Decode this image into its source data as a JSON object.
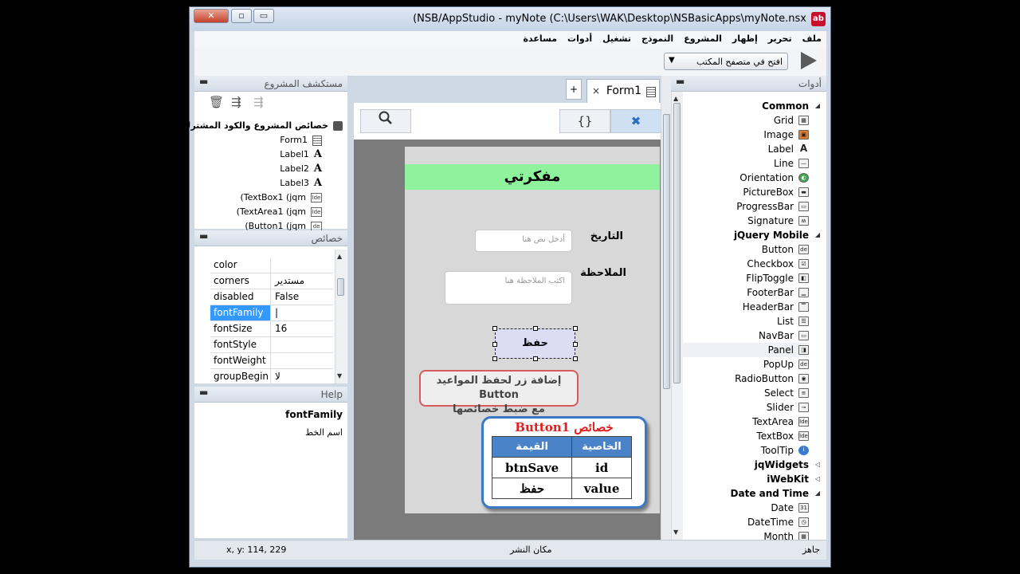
{
  "window": {
    "title": "(NSB/AppStudio - myNote (C:\\Users\\WAK\\Desktop\\NSBasicApps\\myNote.nsx",
    "icon_text": "ab"
  },
  "menu": [
    "ملف",
    "تحرير",
    "إظهار",
    "المشروع",
    "النموذج",
    "تشغيل",
    "أدوات",
    "مساعدة"
  ],
  "toolbar": {
    "browser_option": "افتح في متصفح المكتب"
  },
  "explorer": {
    "title": "مستكشف المشروع",
    "items": [
      {
        "label": "خصائص المشروع والكود المشترك",
        "icon": "gear-icon"
      },
      {
        "label": "Form1",
        "icon": "form-icon"
      },
      {
        "label": "Label1",
        "icon": "label-icon"
      },
      {
        "label": "Label2",
        "icon": "label-icon"
      },
      {
        "label": "Label3",
        "icon": "label-icon"
      },
      {
        "label": "(TextBox1 (jqm",
        "icon": "textbox-icon"
      },
      {
        "label": "(TextArea1 (jqm",
        "icon": "textarea-icon"
      },
      {
        "label": "(Button1 (jqm",
        "icon": "button-icon"
      }
    ]
  },
  "properties": {
    "title": "خصائص",
    "rows": [
      {
        "name": "color",
        "value": ""
      },
      {
        "name": "corners",
        "value": "مستدير"
      },
      {
        "name": "disabled",
        "value": "False"
      },
      {
        "name": "fontFamily",
        "value": "|"
      },
      {
        "name": "fontSize",
        "value": "16"
      },
      {
        "name": "fontStyle",
        "value": ""
      },
      {
        "name": "fontWeight",
        "value": ""
      },
      {
        "name": "groupBegin",
        "value": "لا"
      }
    ]
  },
  "help": {
    "title": "Help",
    "prop_name": "fontFamily",
    "description": "اسم الخط"
  },
  "editor": {
    "tab_label": "Form1",
    "tab_close": "×",
    "tab_add": "+",
    "code_button": "{}"
  },
  "form": {
    "header": "مفكرتي",
    "date_label": "التاريخ",
    "date_placeholder": "أدخل نص هنا",
    "note_label": "الملاحظة",
    "note_placeholder": "اكتب الملاحظة هنا",
    "save_button": "حفظ",
    "callout_line1": "إضافة زر لحفظ المواعيد Button",
    "callout_line2": "مع ضبط خصائصها",
    "card_title": "خصائص Button1",
    "card_headers": [
      "الخاصية",
      "القيمة"
    ],
    "card_rows": [
      {
        "prop": "id",
        "val": "btnSave"
      },
      {
        "prop": "value",
        "val": "حفظ"
      }
    ]
  },
  "tools": {
    "title": "أدوات",
    "items": [
      {
        "label": "Common",
        "group": true,
        "icon": "expanded"
      },
      {
        "label": "Grid",
        "icon": "grid-icon"
      },
      {
        "label": "Image",
        "icon": "image-icon"
      },
      {
        "label": "Label",
        "icon": "label-icon"
      },
      {
        "label": "Line",
        "icon": "line-icon"
      },
      {
        "label": "Orientation",
        "icon": "orientation-icon"
      },
      {
        "label": "PictureBox",
        "icon": "picturebox-icon"
      },
      {
        "label": "ProgressBar",
        "icon": "progressbar-icon"
      },
      {
        "label": "Signature",
        "icon": "signature-icon"
      },
      {
        "label": "jQuery Mobile",
        "group": true,
        "icon": "expanded"
      },
      {
        "label": "Button",
        "icon": "button-icon"
      },
      {
        "label": "Checkbox",
        "icon": "checkbox-icon"
      },
      {
        "label": "FlipToggle",
        "icon": "fliptoggle-icon"
      },
      {
        "label": "FooterBar",
        "icon": "footerbar-icon"
      },
      {
        "label": "HeaderBar",
        "icon": "headerbar-icon"
      },
      {
        "label": "List",
        "icon": "list-icon"
      },
      {
        "label": "NavBar",
        "icon": "navbar-icon"
      },
      {
        "label": "Panel",
        "icon": "panel-icon"
      },
      {
        "label": "PopUp",
        "icon": "popup-icon"
      },
      {
        "label": "RadioButton",
        "icon": "radiobutton-icon"
      },
      {
        "label": "Select",
        "icon": "select-icon"
      },
      {
        "label": "Slider",
        "icon": "slider-icon"
      },
      {
        "label": "TextArea",
        "icon": "textarea-icon"
      },
      {
        "label": "TextBox",
        "icon": "textbox-icon"
      },
      {
        "label": "ToolTip",
        "icon": "tooltip-icon"
      },
      {
        "label": "jqWidgets",
        "group": true,
        "icon": "collapsed"
      },
      {
        "label": "iWebKit",
        "group": true,
        "icon": "collapsed"
      },
      {
        "label": "Date and Time",
        "group": true,
        "icon": "expanded"
      },
      {
        "label": "Date",
        "icon": "date-icon"
      },
      {
        "label": "DateTime",
        "icon": "datetime-icon"
      },
      {
        "label": "Month",
        "icon": "month-icon"
      }
    ]
  },
  "status": {
    "left": "جاهز",
    "center": "مكان النشر",
    "coords": "x, y: 114, 229"
  },
  "colors": {
    "header_green": "#8ff39e",
    "selection_blue": "#3399ff",
    "callout_red": "#d65b5b",
    "card_blue": "#3b78c4"
  }
}
